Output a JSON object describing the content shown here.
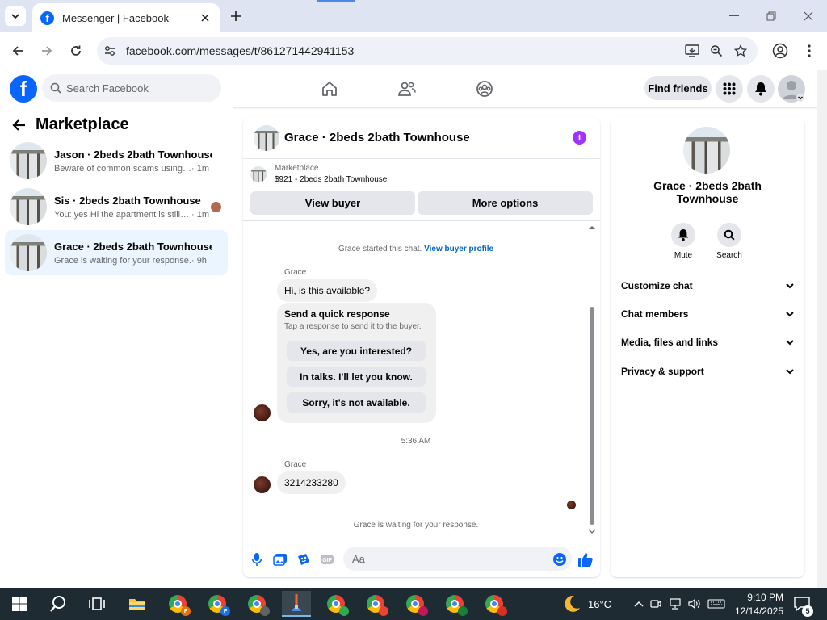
{
  "browser": {
    "tab_title": "Messenger | Facebook",
    "url": "facebook.com/messages/t/861271442941153"
  },
  "facebook": {
    "logo_letter": "f",
    "search_placeholder": "Search Facebook",
    "find_friends": "Find friends"
  },
  "sidebar": {
    "title": "Marketplace",
    "conversations": [
      {
        "name": "Jason · 2beds 2bath Townhouse",
        "preview": "Beware of common scams using pay...",
        "time": " · 1m"
      },
      {
        "name": "Sis · 2beds 2bath Townhouse",
        "preview": "You: yes Hi the apartment is still av...",
        "time": " · 1m"
      },
      {
        "name": "Grace · 2beds 2bath Townhouse",
        "preview": "Grace is waiting for your response.",
        "time": " · 9h"
      }
    ]
  },
  "chat": {
    "title": "Grace · 2beds 2bath Townhouse",
    "info_glyph": "i",
    "listing_source": "Marketplace",
    "listing": "$921 - 2beds 2bath Townhouse",
    "view_buyer": "View buyer",
    "more_options": "More options",
    "started_text": "Grace started this chat.",
    "view_profile_link": "View buyer profile",
    "sender_1": "Grace",
    "message_1": "Hi, is this available?",
    "quick_title": "Send a quick response",
    "quick_subtitle": "Tap a response to send it to the buyer.",
    "quick_options": [
      "Yes, are you interested?",
      "In talks. I'll let you know.",
      "Sorry, it's not available."
    ],
    "timestamp": "5:36 AM",
    "sender_2": "Grace",
    "message_2": "3214233280",
    "waiting": "Grace is waiting for your response.",
    "composer_placeholder": "Aa"
  },
  "details": {
    "name": "Grace · 2beds 2bath Townhouse",
    "mute": "Mute",
    "search": "Search",
    "sections": [
      "Customize chat",
      "Chat members",
      "Media, files and links",
      "Privacy & support"
    ]
  },
  "taskbar": {
    "weather": "16°C",
    "time": "9:10 PM",
    "date": "12/14/2025",
    "notifications": "5"
  },
  "colors": {
    "facebook_blue": "#0866ff",
    "link_blue": "#0064d1",
    "info_purple": "#a033ff",
    "active_conversation": "#ebf5ff"
  }
}
